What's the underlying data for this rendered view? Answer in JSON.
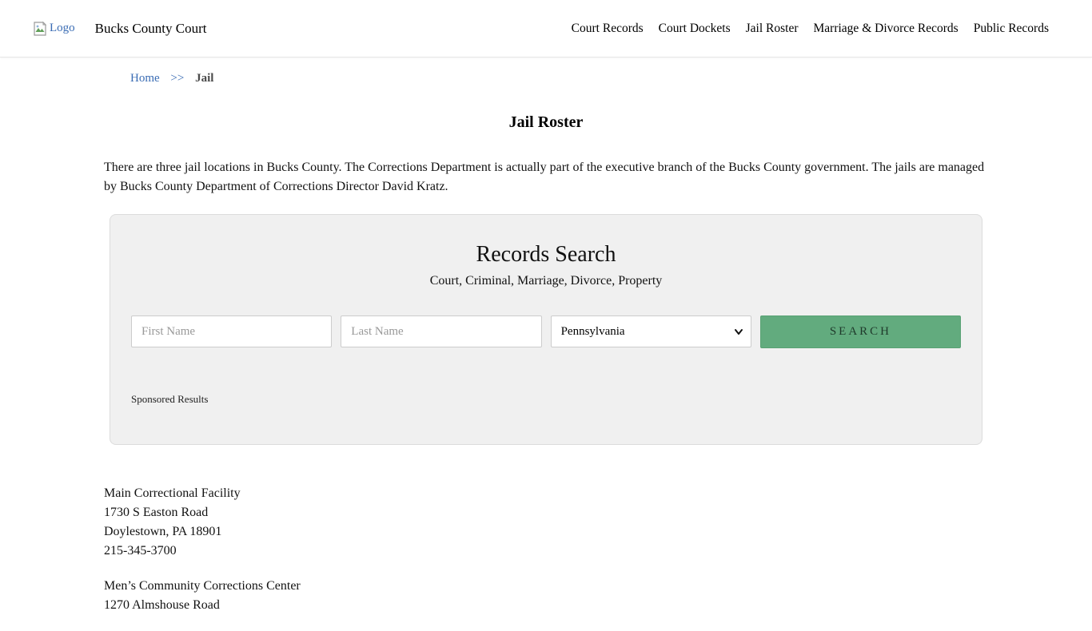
{
  "header": {
    "logo_alt": "Logo",
    "site_title": "Bucks County Court",
    "nav": [
      {
        "label": "Court Records"
      },
      {
        "label": "Court Dockets"
      },
      {
        "label": "Jail Roster"
      },
      {
        "label": "Marriage & Divorce Records"
      },
      {
        "label": "Public Records"
      }
    ]
  },
  "breadcrumb": {
    "home": "Home",
    "separator": ">>",
    "current": "Jail"
  },
  "page": {
    "title": "Jail Roster",
    "intro": "There are three jail locations in Bucks County. The Corrections Department is actually part of the executive branch of the Bucks County government. The jails are managed by Bucks County Department of Corrections Director David Kratz."
  },
  "search": {
    "title": "Records Search",
    "subtitle": "Court, Criminal, Marriage, Divorce, Property",
    "first_name_placeholder": "First Name",
    "last_name_placeholder": "Last Name",
    "state_selected": "Pennsylvania",
    "button_label": "SEARCH",
    "button_color": "#62ab7e",
    "sponsored_label": "Sponsored Results"
  },
  "locations": [
    {
      "line1": "Main Correctional Facility",
      "line2": "1730 S Easton Road",
      "line3": "Doylestown, PA 18901",
      "line4": "215-345-3700"
    },
    {
      "line1": "Men’s Community Corrections Center",
      "line2": "1270 Almshouse Road",
      "line3": "",
      "line4": ""
    }
  ]
}
